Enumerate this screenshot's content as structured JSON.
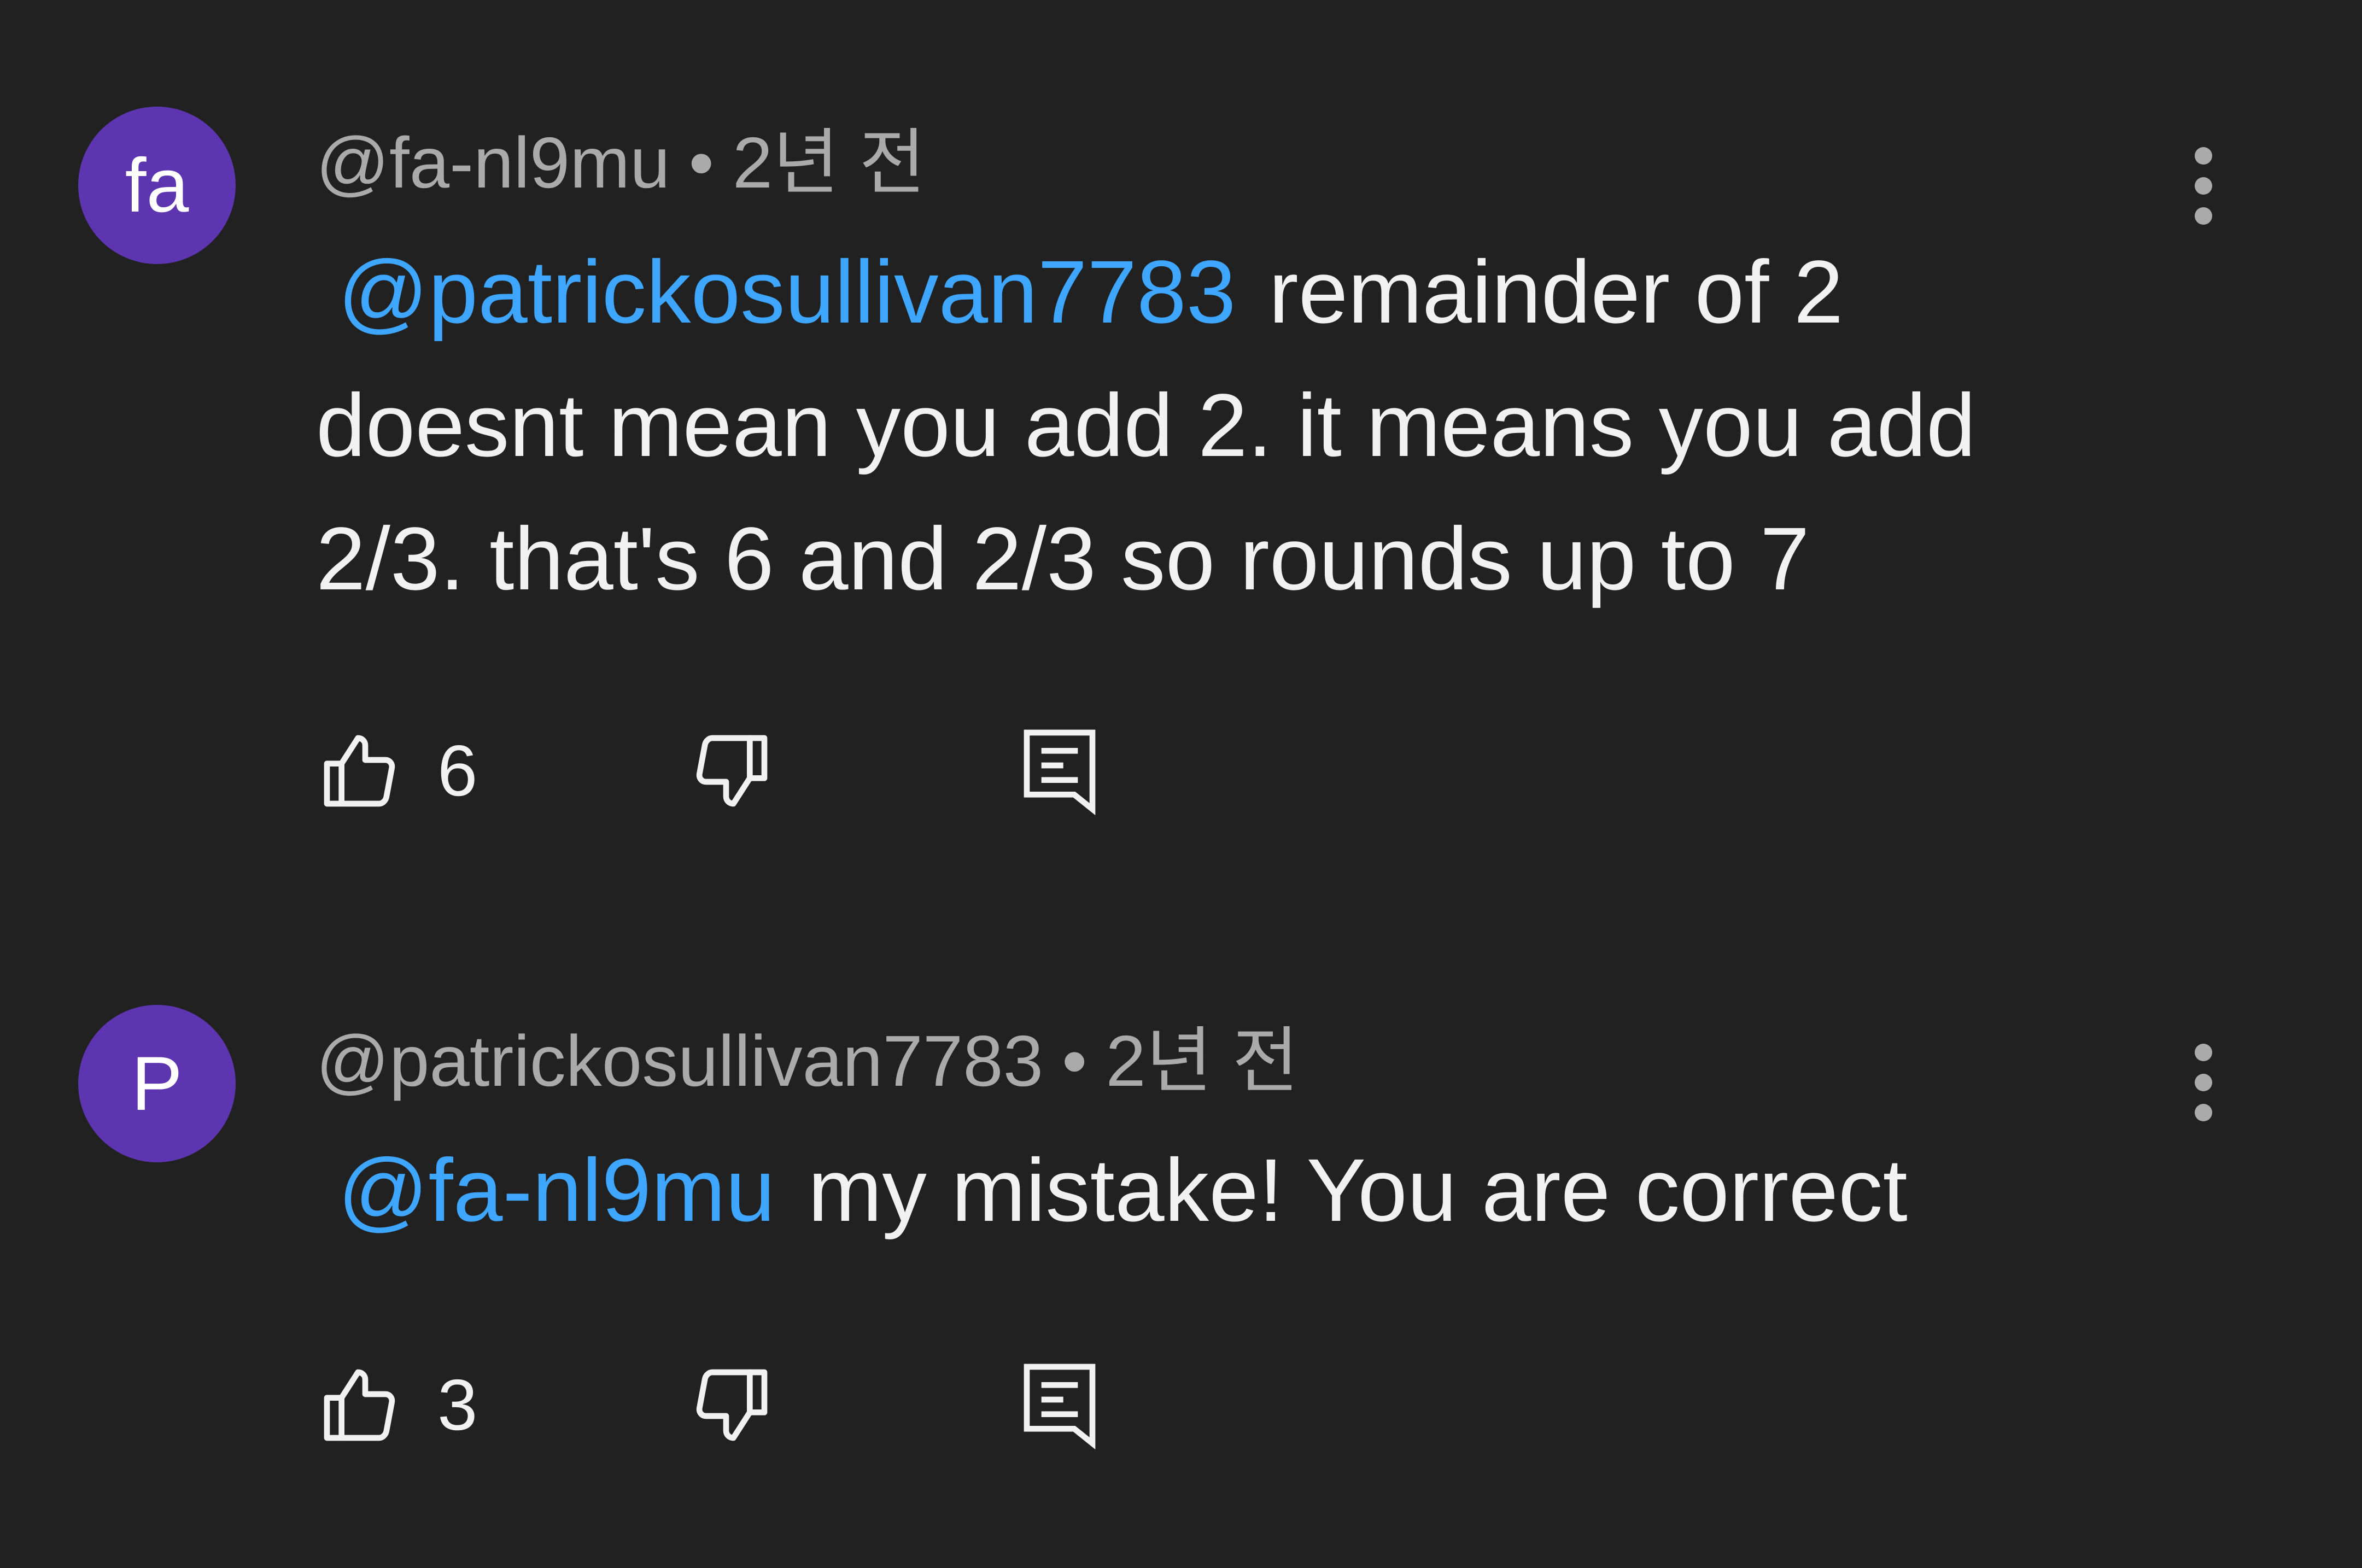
{
  "colors": {
    "background": "#212121",
    "text_primary": "#f1f1f1",
    "text_secondary": "#aaaaaa",
    "mention": "#3ea6ff",
    "avatar_background": "#5e35b1"
  },
  "comments": [
    {
      "avatar_text": "fa",
      "author": "@fa-nl9mu",
      "separator": "•",
      "time": "2년 전",
      "mention": "@patrickosullivan7783",
      "text": "remainder of 2 doesnt mean you add 2. it means you add 2/3. that's 6 and 2/3 so rounds up to 7",
      "like_count": "6",
      "icons": {
        "like": "thumbs-up-icon",
        "dislike": "thumbs-down-icon",
        "reply": "reply-comment-icon",
        "more": "more-vert-icon"
      }
    },
    {
      "avatar_text": "P",
      "author": "@patrickosullivan7783",
      "separator": "•",
      "time": "2년 전",
      "mention": "@fa-nl9mu",
      "text": "my mistake! You are correct",
      "like_count": "3",
      "icons": {
        "like": "thumbs-up-icon",
        "dislike": "thumbs-down-icon",
        "reply": "reply-comment-icon",
        "more": "more-vert-icon"
      }
    }
  ]
}
